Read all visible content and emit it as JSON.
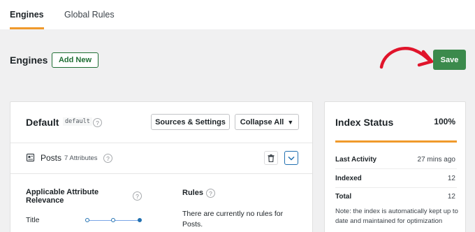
{
  "tabs": [
    {
      "label": "Engines"
    },
    {
      "label": "Global Rules"
    }
  ],
  "page": {
    "title": "Engines",
    "add_new_label": "Add New",
    "save_label": "Save"
  },
  "engine": {
    "name": "Default",
    "code": "default",
    "help": "?",
    "sources_settings_label": "Sources & Settings",
    "collapse_all_label": "Collapse All",
    "source": {
      "name": "Posts",
      "attributes": "7 Attributes"
    },
    "attribute_relevance_heading": "Applicable Attribute Relevance",
    "attribute": {
      "label": "Title",
      "relevance_level": 1
    },
    "rules_heading": "Rules",
    "rules_text": "There are currently no rules for Posts."
  },
  "index_status": {
    "title": "Index Status",
    "percent": "100%",
    "progress": 1.0,
    "stats": [
      {
        "label": "Last Activity",
        "value": "27 mins ago"
      },
      {
        "label": "Indexed",
        "value": "12"
      },
      {
        "label": "Total",
        "value": "12"
      }
    ],
    "note": "Note: the index is automatically kept up to date and maintained for optimization"
  },
  "colors": {
    "accent": "#f09a2c",
    "save_green": "#3b8a4c",
    "annotation_red": "#e0142b"
  }
}
